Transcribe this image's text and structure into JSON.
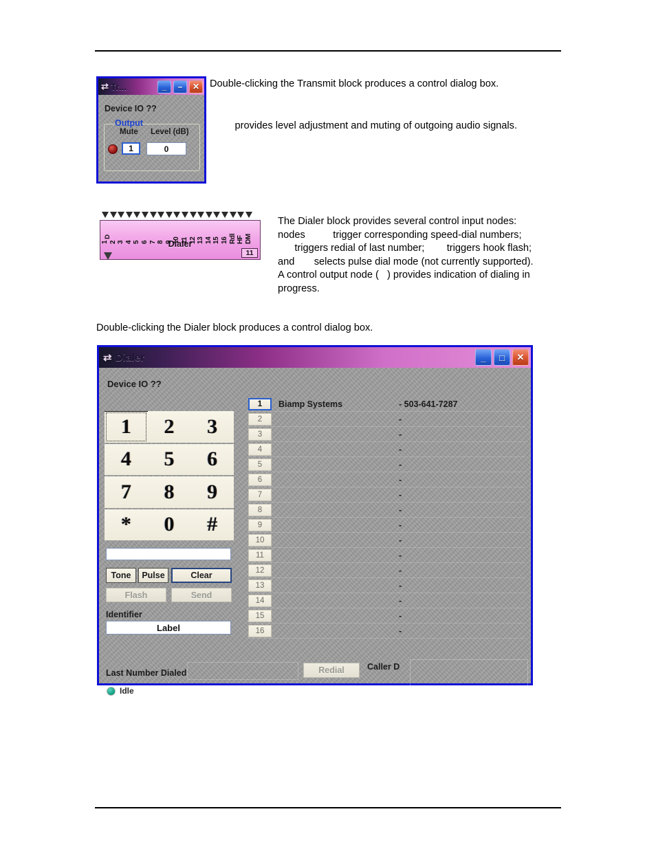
{
  "page": {
    "paragraphs": {
      "transmit_intro": "Double-clicking the Transmit block produces a control dialog box.",
      "transmit_desc": "         provides level adjustment and muting of outgoing audio signals.",
      "dialer_block_desc": "The Dialer block provides several control input nodes:\nnodes          trigger corresponding speed-dial numbers;\n      triggers redial of last number;        triggers hook flash;\nand       selects pulse dial mode (not currently supported).\nA control output node (   ) provides indication of dialing in\nprogress.",
      "dialer_intro": "Double-clicking the Dialer block produces a control dialog box."
    }
  },
  "transmit_dialog": {
    "title": "Tr...",
    "icon": "transmit-arrows-icon",
    "window_buttons": {
      "minimize": "_",
      "maximize": "–",
      "close": "✕"
    },
    "device_label": "Device IO   ??",
    "group_label": "Output",
    "mute_label": "Mute",
    "level_label": "Level (dB)",
    "mute_value": "1",
    "level_value": "0"
  },
  "dialer_block": {
    "title": "Dialer",
    "badge": "11",
    "input_nodes": [
      "1",
      "2",
      "3",
      "4",
      "5",
      "6",
      "7",
      "8",
      "9",
      "10",
      "11",
      "12",
      "13",
      "14",
      "15",
      "16",
      "Rdl",
      "HF",
      "DM"
    ],
    "output_node": "D"
  },
  "dialer_dialog": {
    "title": "Dialer",
    "icon": "transmit-arrows-icon",
    "window_buttons": {
      "minimize": "_",
      "maximize": "□",
      "close": "✕"
    },
    "device_label": "Device IO  ??",
    "keypad": [
      "1",
      "2",
      "3",
      "4",
      "5",
      "6",
      "7",
      "8",
      "9",
      "*",
      "0",
      "#"
    ],
    "keypad_focused": "1",
    "entry_value": "",
    "buttons": {
      "tone": "Tone",
      "pulse": "Pulse",
      "clear": "Clear",
      "flash": "Flash",
      "send": "Send",
      "redial": "Redial"
    },
    "identifier_label": "Identifier",
    "identifier_value": "Label",
    "last_number_label": "Last Number Dialed",
    "last_number_value": "",
    "caller_id_label": "Caller D",
    "caller_id_value": "",
    "status_label": "Idle",
    "status_color": "#12a58a",
    "speed_dials": [
      {
        "num": "1",
        "name": "Biamp Systems",
        "phone": "- 503-641-7287"
      },
      {
        "num": "2",
        "name": "",
        "phone": "-"
      },
      {
        "num": "3",
        "name": "",
        "phone": "-"
      },
      {
        "num": "4",
        "name": "",
        "phone": "-"
      },
      {
        "num": "5",
        "name": "",
        "phone": "-"
      },
      {
        "num": "6",
        "name": "",
        "phone": "-"
      },
      {
        "num": "7",
        "name": "",
        "phone": "-"
      },
      {
        "num": "8",
        "name": "",
        "phone": "-"
      },
      {
        "num": "9",
        "name": "",
        "phone": "-"
      },
      {
        "num": "10",
        "name": "",
        "phone": "-"
      },
      {
        "num": "11",
        "name": "",
        "phone": "-"
      },
      {
        "num": "12",
        "name": "",
        "phone": "-"
      },
      {
        "num": "13",
        "name": "",
        "phone": "-"
      },
      {
        "num": "14",
        "name": "",
        "phone": "-"
      },
      {
        "num": "15",
        "name": "",
        "phone": "-"
      },
      {
        "num": "16",
        "name": "",
        "phone": "-"
      }
    ]
  },
  "colors": {
    "dialog_border": "#1010d8",
    "dialog_face": "#9d9d9d",
    "title_accent": "#d06fc8",
    "block_pink": "#f2a8e8",
    "link_blue": "#1a3fd0"
  }
}
